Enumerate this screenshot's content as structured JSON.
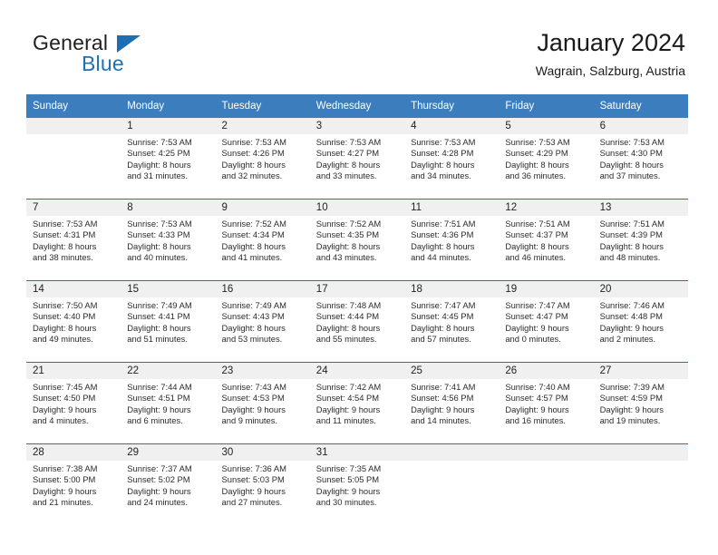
{
  "brand": {
    "name_part1": "General",
    "name_part2": "Blue",
    "accent_color": "#1c72b8",
    "triangle_icon": "triangle-icon"
  },
  "header": {
    "title": "January 2024",
    "subtitle": "Wagrain, Salzburg, Austria"
  },
  "calendar": {
    "header_bg": "#3b7dbd",
    "day_band_bg": "#f0f0f0",
    "weekdays": [
      "Sunday",
      "Monday",
      "Tuesday",
      "Wednesday",
      "Thursday",
      "Friday",
      "Saturday"
    ],
    "weeks": [
      [
        {
          "day": "",
          "empty": true
        },
        {
          "day": "1",
          "sunrise": "Sunrise: 7:53 AM",
          "sunset": "Sunset: 4:25 PM",
          "daylight_line1": "Daylight: 8 hours",
          "daylight_line2": "and 31 minutes."
        },
        {
          "day": "2",
          "sunrise": "Sunrise: 7:53 AM",
          "sunset": "Sunset: 4:26 PM",
          "daylight_line1": "Daylight: 8 hours",
          "daylight_line2": "and 32 minutes."
        },
        {
          "day": "3",
          "sunrise": "Sunrise: 7:53 AM",
          "sunset": "Sunset: 4:27 PM",
          "daylight_line1": "Daylight: 8 hours",
          "daylight_line2": "and 33 minutes."
        },
        {
          "day": "4",
          "sunrise": "Sunrise: 7:53 AM",
          "sunset": "Sunset: 4:28 PM",
          "daylight_line1": "Daylight: 8 hours",
          "daylight_line2": "and 34 minutes."
        },
        {
          "day": "5",
          "sunrise": "Sunrise: 7:53 AM",
          "sunset": "Sunset: 4:29 PM",
          "daylight_line1": "Daylight: 8 hours",
          "daylight_line2": "and 36 minutes."
        },
        {
          "day": "6",
          "sunrise": "Sunrise: 7:53 AM",
          "sunset": "Sunset: 4:30 PM",
          "daylight_line1": "Daylight: 8 hours",
          "daylight_line2": "and 37 minutes."
        }
      ],
      [
        {
          "day": "7",
          "sunrise": "Sunrise: 7:53 AM",
          "sunset": "Sunset: 4:31 PM",
          "daylight_line1": "Daylight: 8 hours",
          "daylight_line2": "and 38 minutes."
        },
        {
          "day": "8",
          "sunrise": "Sunrise: 7:53 AM",
          "sunset": "Sunset: 4:33 PM",
          "daylight_line1": "Daylight: 8 hours",
          "daylight_line2": "and 40 minutes."
        },
        {
          "day": "9",
          "sunrise": "Sunrise: 7:52 AM",
          "sunset": "Sunset: 4:34 PM",
          "daylight_line1": "Daylight: 8 hours",
          "daylight_line2": "and 41 minutes."
        },
        {
          "day": "10",
          "sunrise": "Sunrise: 7:52 AM",
          "sunset": "Sunset: 4:35 PM",
          "daylight_line1": "Daylight: 8 hours",
          "daylight_line2": "and 43 minutes."
        },
        {
          "day": "11",
          "sunrise": "Sunrise: 7:51 AM",
          "sunset": "Sunset: 4:36 PM",
          "daylight_line1": "Daylight: 8 hours",
          "daylight_line2": "and 44 minutes."
        },
        {
          "day": "12",
          "sunrise": "Sunrise: 7:51 AM",
          "sunset": "Sunset: 4:37 PM",
          "daylight_line1": "Daylight: 8 hours",
          "daylight_line2": "and 46 minutes."
        },
        {
          "day": "13",
          "sunrise": "Sunrise: 7:51 AM",
          "sunset": "Sunset: 4:39 PM",
          "daylight_line1": "Daylight: 8 hours",
          "daylight_line2": "and 48 minutes."
        }
      ],
      [
        {
          "day": "14",
          "sunrise": "Sunrise: 7:50 AM",
          "sunset": "Sunset: 4:40 PM",
          "daylight_line1": "Daylight: 8 hours",
          "daylight_line2": "and 49 minutes."
        },
        {
          "day": "15",
          "sunrise": "Sunrise: 7:49 AM",
          "sunset": "Sunset: 4:41 PM",
          "daylight_line1": "Daylight: 8 hours",
          "daylight_line2": "and 51 minutes."
        },
        {
          "day": "16",
          "sunrise": "Sunrise: 7:49 AM",
          "sunset": "Sunset: 4:43 PM",
          "daylight_line1": "Daylight: 8 hours",
          "daylight_line2": "and 53 minutes."
        },
        {
          "day": "17",
          "sunrise": "Sunrise: 7:48 AM",
          "sunset": "Sunset: 4:44 PM",
          "daylight_line1": "Daylight: 8 hours",
          "daylight_line2": "and 55 minutes."
        },
        {
          "day": "18",
          "sunrise": "Sunrise: 7:47 AM",
          "sunset": "Sunset: 4:45 PM",
          "daylight_line1": "Daylight: 8 hours",
          "daylight_line2": "and 57 minutes."
        },
        {
          "day": "19",
          "sunrise": "Sunrise: 7:47 AM",
          "sunset": "Sunset: 4:47 PM",
          "daylight_line1": "Daylight: 9 hours",
          "daylight_line2": "and 0 minutes."
        },
        {
          "day": "20",
          "sunrise": "Sunrise: 7:46 AM",
          "sunset": "Sunset: 4:48 PM",
          "daylight_line1": "Daylight: 9 hours",
          "daylight_line2": "and 2 minutes."
        }
      ],
      [
        {
          "day": "21",
          "sunrise": "Sunrise: 7:45 AM",
          "sunset": "Sunset: 4:50 PM",
          "daylight_line1": "Daylight: 9 hours",
          "daylight_line2": "and 4 minutes."
        },
        {
          "day": "22",
          "sunrise": "Sunrise: 7:44 AM",
          "sunset": "Sunset: 4:51 PM",
          "daylight_line1": "Daylight: 9 hours",
          "daylight_line2": "and 6 minutes."
        },
        {
          "day": "23",
          "sunrise": "Sunrise: 7:43 AM",
          "sunset": "Sunset: 4:53 PM",
          "daylight_line1": "Daylight: 9 hours",
          "daylight_line2": "and 9 minutes."
        },
        {
          "day": "24",
          "sunrise": "Sunrise: 7:42 AM",
          "sunset": "Sunset: 4:54 PM",
          "daylight_line1": "Daylight: 9 hours",
          "daylight_line2": "and 11 minutes."
        },
        {
          "day": "25",
          "sunrise": "Sunrise: 7:41 AM",
          "sunset": "Sunset: 4:56 PM",
          "daylight_line1": "Daylight: 9 hours",
          "daylight_line2": "and 14 minutes."
        },
        {
          "day": "26",
          "sunrise": "Sunrise: 7:40 AM",
          "sunset": "Sunset: 4:57 PM",
          "daylight_line1": "Daylight: 9 hours",
          "daylight_line2": "and 16 minutes."
        },
        {
          "day": "27",
          "sunrise": "Sunrise: 7:39 AM",
          "sunset": "Sunset: 4:59 PM",
          "daylight_line1": "Daylight: 9 hours",
          "daylight_line2": "and 19 minutes."
        }
      ],
      [
        {
          "day": "28",
          "sunrise": "Sunrise: 7:38 AM",
          "sunset": "Sunset: 5:00 PM",
          "daylight_line1": "Daylight: 9 hours",
          "daylight_line2": "and 21 minutes."
        },
        {
          "day": "29",
          "sunrise": "Sunrise: 7:37 AM",
          "sunset": "Sunset: 5:02 PM",
          "daylight_line1": "Daylight: 9 hours",
          "daylight_line2": "and 24 minutes."
        },
        {
          "day": "30",
          "sunrise": "Sunrise: 7:36 AM",
          "sunset": "Sunset: 5:03 PM",
          "daylight_line1": "Daylight: 9 hours",
          "daylight_line2": "and 27 minutes."
        },
        {
          "day": "31",
          "sunrise": "Sunrise: 7:35 AM",
          "sunset": "Sunset: 5:05 PM",
          "daylight_line1": "Daylight: 9 hours",
          "daylight_line2": "and 30 minutes."
        },
        {
          "day": "",
          "empty": true
        },
        {
          "day": "",
          "empty": true
        },
        {
          "day": "",
          "empty": true
        }
      ]
    ]
  }
}
